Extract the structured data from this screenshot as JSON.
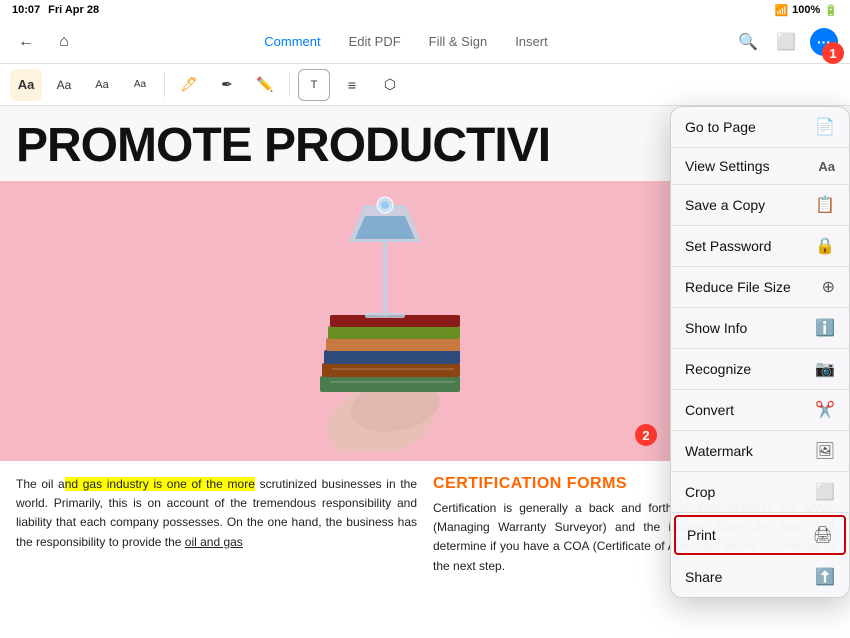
{
  "statusBar": {
    "time": "10:07",
    "day": "Fri Apr 28",
    "battery": "100%",
    "batteryIcon": "🔋"
  },
  "nav": {
    "tabs": [
      {
        "id": "comment",
        "label": "Comment",
        "active": true
      },
      {
        "id": "editpdf",
        "label": "Edit PDF",
        "active": false
      },
      {
        "id": "fillsign",
        "label": "Fill & Sign",
        "active": false
      },
      {
        "id": "insert",
        "label": "Insert",
        "active": false
      }
    ]
  },
  "toolbar": {
    "items": [
      {
        "id": "text1",
        "label": "Aa",
        "style": "serif"
      },
      {
        "id": "text2",
        "label": "Aa",
        "style": "normal"
      },
      {
        "id": "text3",
        "label": "Aa",
        "style": "small"
      },
      {
        "id": "text4",
        "label": "Aa",
        "style": "tiny"
      },
      {
        "id": "highlight",
        "label": "🖊",
        "active": false
      },
      {
        "id": "strikethrough",
        "label": "✏",
        "active": false
      },
      {
        "id": "pencil",
        "label": "✏",
        "active": false
      },
      {
        "id": "text-box",
        "label": "T",
        "active": false
      },
      {
        "id": "list",
        "label": "≡",
        "active": false
      },
      {
        "id": "image",
        "label": "⬜",
        "active": false
      }
    ]
  },
  "pdf": {
    "title": "PROMOTE PRODUCTIVI",
    "bodyLeft": "The oil and gas industry is one of the more scrutinized businesses in the world. Primarily, this is on account of the tremendous responsibility and liability that each company possesses. On the one hand, the business has the responsibility to provide the oil and gas",
    "highlightedText": "nd gas industry is one of the more",
    "bodyRightTitle": "CERTIFICATION FORMS",
    "bodyRight": "Certification is generally a back and forth of fixes between the MWS (Managing Warranty Surveyor) and the insurer. Since the MWS will determine if you have a COA (Certificate of Authority) before proceeding to the next step."
  },
  "menu": {
    "items": [
      {
        "id": "goto",
        "label": "Go to Page",
        "icon": "📄"
      },
      {
        "id": "viewsettings",
        "label": "View Settings",
        "icon": "Aa"
      },
      {
        "id": "saveacopy",
        "label": "Save a Copy",
        "icon": "📋"
      },
      {
        "id": "setpassword",
        "label": "Set Password",
        "icon": "🔒"
      },
      {
        "id": "reducefilesize",
        "label": "Reduce File Size",
        "icon": "➕"
      },
      {
        "id": "showinfo",
        "label": "Show Info",
        "icon": "ℹ"
      },
      {
        "id": "recognize",
        "label": "Recognize",
        "icon": "📷"
      },
      {
        "id": "convert",
        "label": "Convert",
        "icon": "✂"
      },
      {
        "id": "watermark",
        "label": "Watermark",
        "icon": "📑"
      },
      {
        "id": "crop",
        "label": "Crop",
        "icon": "⬜"
      },
      {
        "id": "print",
        "label": "Print",
        "icon": "🖨"
      },
      {
        "id": "share",
        "label": "Share",
        "icon": "⬆"
      }
    ]
  },
  "badges": {
    "badge1": "1",
    "badge2": "2"
  }
}
